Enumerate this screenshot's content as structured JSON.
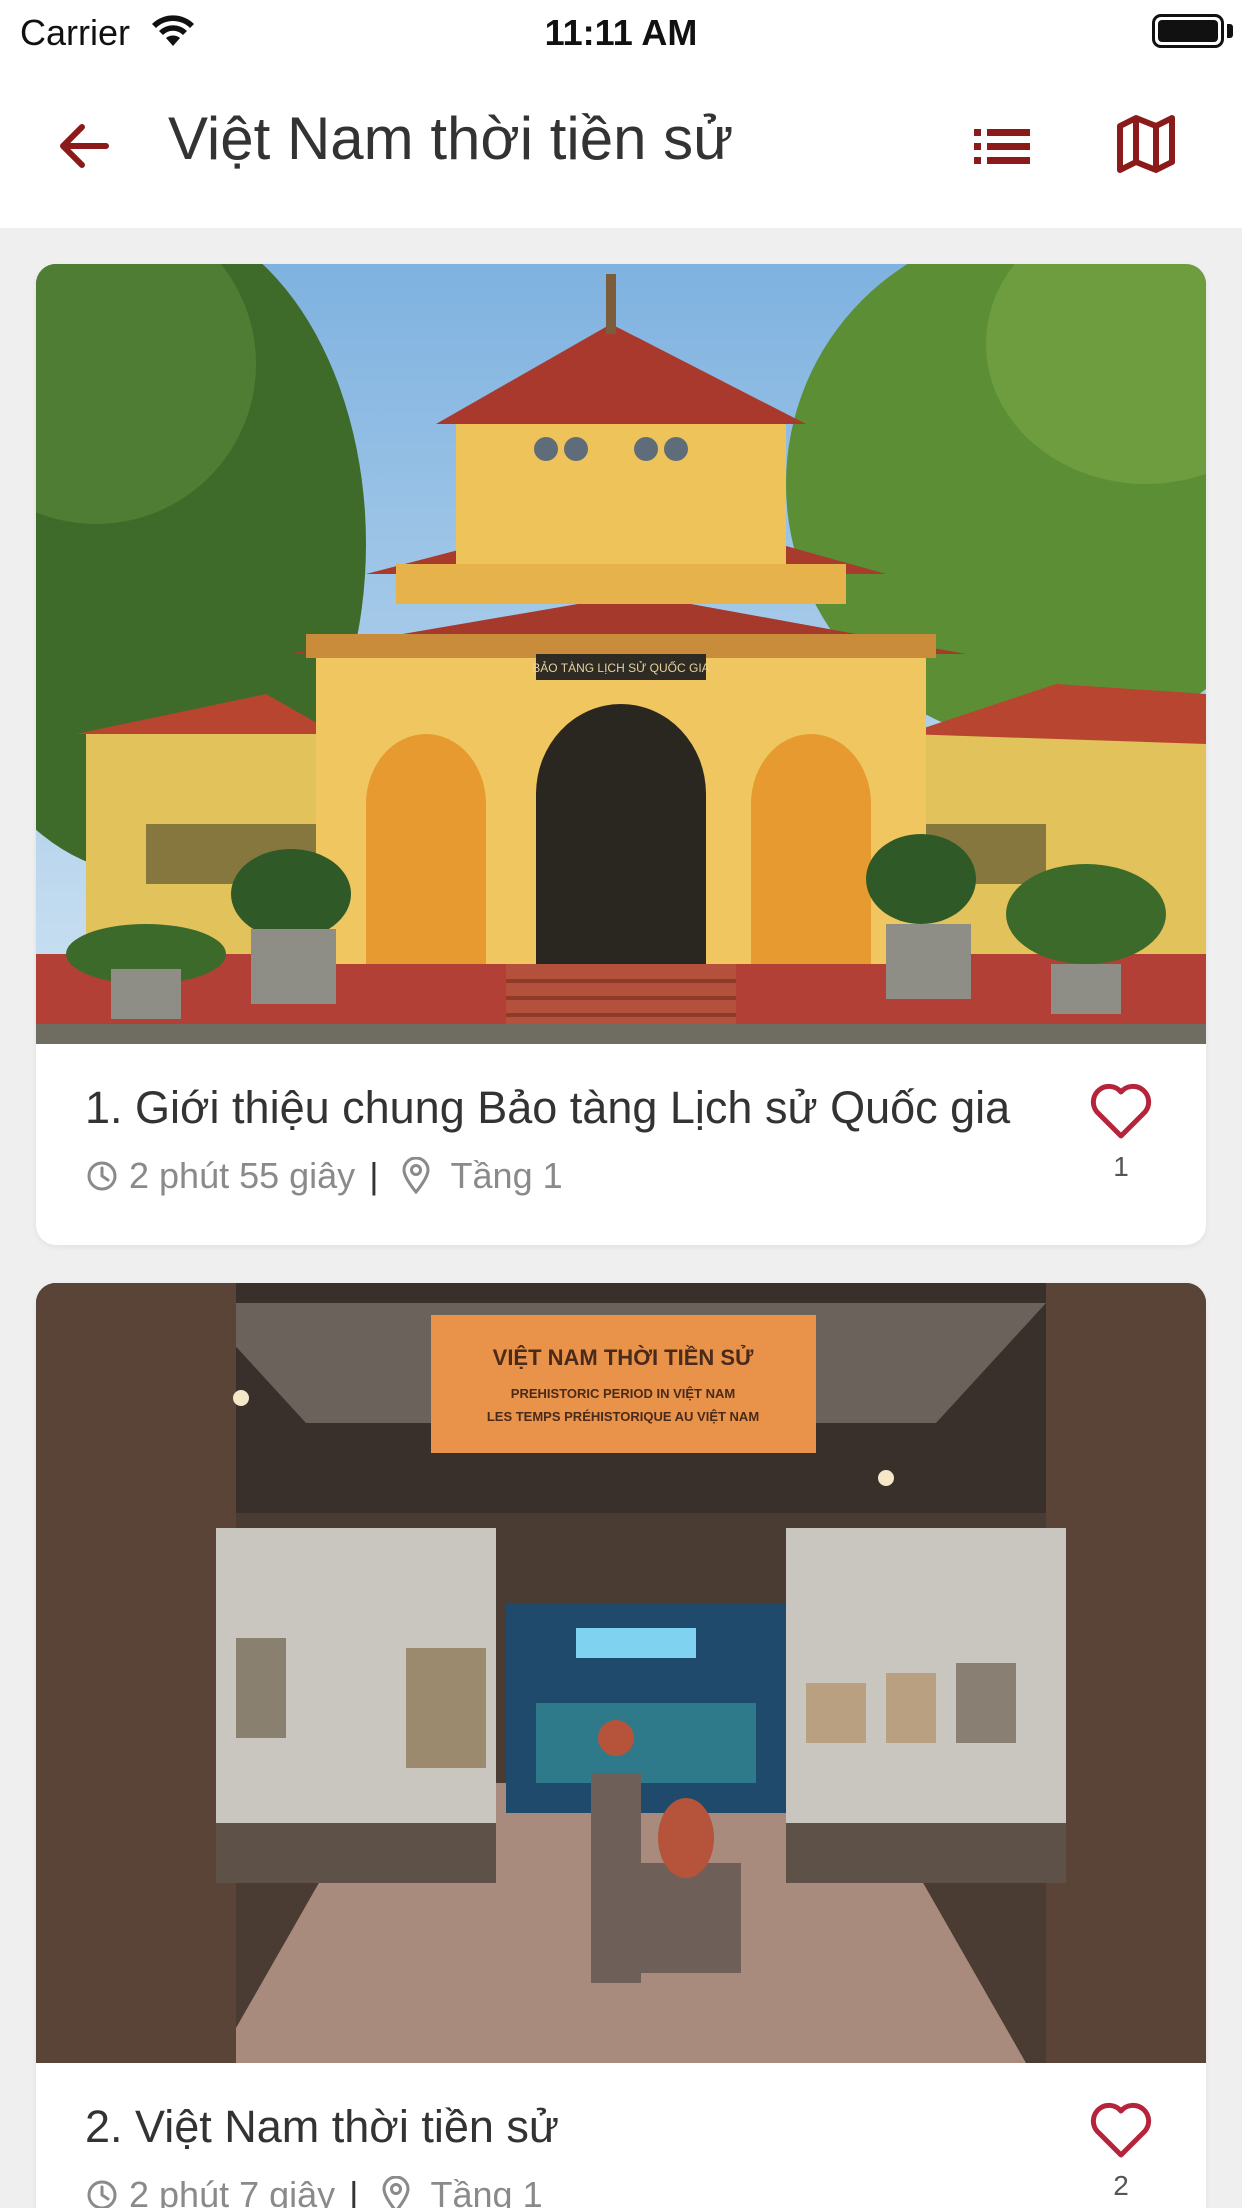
{
  "status_bar": {
    "carrier": "Carrier",
    "time": "11:11 AM"
  },
  "header": {
    "title": "Việt Nam thời tiền sử"
  },
  "colors": {
    "accent": "#8b1a1a",
    "heart": "#b5243a",
    "meta_text": "#8a8a8a"
  },
  "cards": [
    {
      "title": "1. Giới thiệu chung Bảo tàng Lịch sử Quốc gia",
      "duration": "2 phút 55 giây",
      "separator": "|",
      "floor": "Tầng 1",
      "likes": "1",
      "image_sign": "BẢO TÀNG LỊCH SỬ QUỐC GIA"
    },
    {
      "title": "2. Việt Nam thời tiền sử",
      "duration": "2 phút 7 giây",
      "separator": "|",
      "floor": "Tầng 1",
      "likes": "2",
      "image_sign": "VIỆT NAM THỜI TIỀN SỬ",
      "image_sign_en": "PREHISTORIC PERIOD IN VIỆT NAM",
      "image_sign_fr": "LES TEMPS PRÉHISTORIQUE AU VIỆT NAM"
    }
  ]
}
